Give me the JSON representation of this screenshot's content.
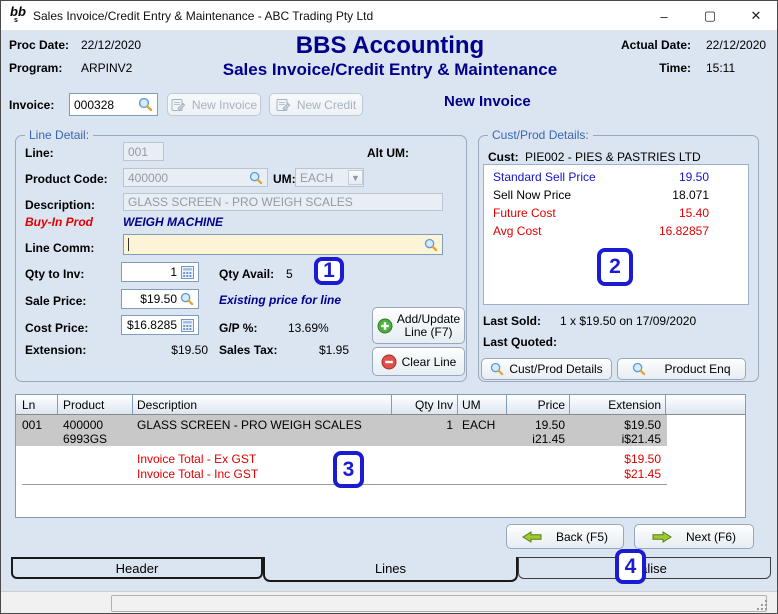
{
  "window": {
    "title": "Sales Invoice/Credit Entry & Maintenance - ABC Trading Pty Ltd",
    "minimize": "–",
    "maximize": "▢",
    "close": "✕"
  },
  "header": {
    "proc_date_label": "Proc Date:",
    "proc_date": "22/12/2020",
    "program_label": "Program:",
    "program": "ARPINV2",
    "app_title": "BBS Accounting",
    "app_subtitle": "Sales Invoice/Credit Entry & Maintenance",
    "actual_date_label": "Actual Date:",
    "actual_date": "22/12/2020",
    "time_label": "Time:",
    "time": "15:11"
  },
  "invoice_bar": {
    "invoice_label": "Invoice:",
    "invoice_number": "000328",
    "new_invoice_button": "New Invoice",
    "new_credit_button": "New Credit",
    "mode_text": "New Invoice"
  },
  "line_detail": {
    "group_label": "Line Detail:",
    "line_label": "Line:",
    "line_value": "001",
    "alt_um_label": "Alt UM:",
    "product_code_label": "Product Code:",
    "product_code": "400000",
    "um_label": "UM:",
    "um_value": "EACH",
    "description_label": "Description:",
    "description": "GLASS SCREEN - PRO WEIGH SCALES",
    "buy_in_prod": "Buy-In Prod",
    "product_group": "WEIGH MACHINE",
    "line_comm_label": "Line Comm:",
    "line_comm": "",
    "qty_to_inv_label": "Qty to Inv:",
    "qty_to_inv": "1",
    "qty_avail_label": "Qty Avail:",
    "qty_avail": "5",
    "sale_price_label": "Sale Price:",
    "sale_price": "$19.50",
    "existing_price_note": "Existing price for line",
    "cost_price_label": "Cost Price:",
    "cost_price": "$16.8285",
    "gp_label": "G/P %:",
    "gp_value": "13.69%",
    "extension_label": "Extension:",
    "extension_value": "$19.50",
    "sales_tax_label": "Sales Tax:",
    "sales_tax_value": "$1.95",
    "add_update_button": "Add/Update Line (F7)",
    "clear_line_button": "Clear Line"
  },
  "cust_prod": {
    "group_label": "Cust/Prod Details:",
    "cust_label": "Cust:",
    "cust_value": "PIE002 - PIES & PASTRIES LTD",
    "price_rows": [
      {
        "label": "Standard Sell Price",
        "value": "19.50",
        "color": "blue"
      },
      {
        "label": "Sell Now Price",
        "value": "18.071",
        "color": "black"
      },
      {
        "label": "Future Cost",
        "value": "15.40",
        "color": "red"
      },
      {
        "label": "Avg Cost",
        "value": "16.82857",
        "color": "red"
      }
    ],
    "last_sold_label": "Last Sold:",
    "last_sold": "1 x $19.50 on 17/09/2020",
    "last_quoted_label": "Last Quoted:",
    "last_quoted": "",
    "cust_prod_details_button": "Cust/Prod Details",
    "product_enq_button": "Product Enq"
  },
  "lines_table": {
    "columns": [
      "Ln",
      "Product",
      "Description",
      "Qty Inv",
      "UM",
      "Price",
      "Extension"
    ],
    "rows": [
      {
        "ln": "001",
        "product": "400000",
        "product_alt": "6993GS",
        "description": "GLASS SCREEN - PRO WEIGH SCALES",
        "qty_inv": "1",
        "um": "EACH",
        "price": "19.50",
        "price_inc": "i21.45",
        "extension": "$19.50",
        "extension_inc": "i$21.45"
      }
    ],
    "totals": [
      {
        "label": "Invoice Total - Ex GST",
        "value": "$19.50"
      },
      {
        "label": "Invoice Total - Inc GST",
        "value": "$21.45"
      }
    ]
  },
  "nav": {
    "back_button": "Back (F5)",
    "next_button": "Next (F6)"
  },
  "tabs": [
    {
      "label": "Header"
    },
    {
      "label": "Lines"
    },
    {
      "label": "Finalise"
    }
  ],
  "annotations": [
    "1",
    "2",
    "3",
    "4"
  ],
  "colors": {
    "background": "#dbe4f1",
    "navy": "#00008b",
    "red": "#e00000",
    "blue": "#1414cc",
    "badge_blue": "#1b1bd1",
    "selected_row": "#c8c8c8",
    "comment_field": "#fdf3d7"
  }
}
